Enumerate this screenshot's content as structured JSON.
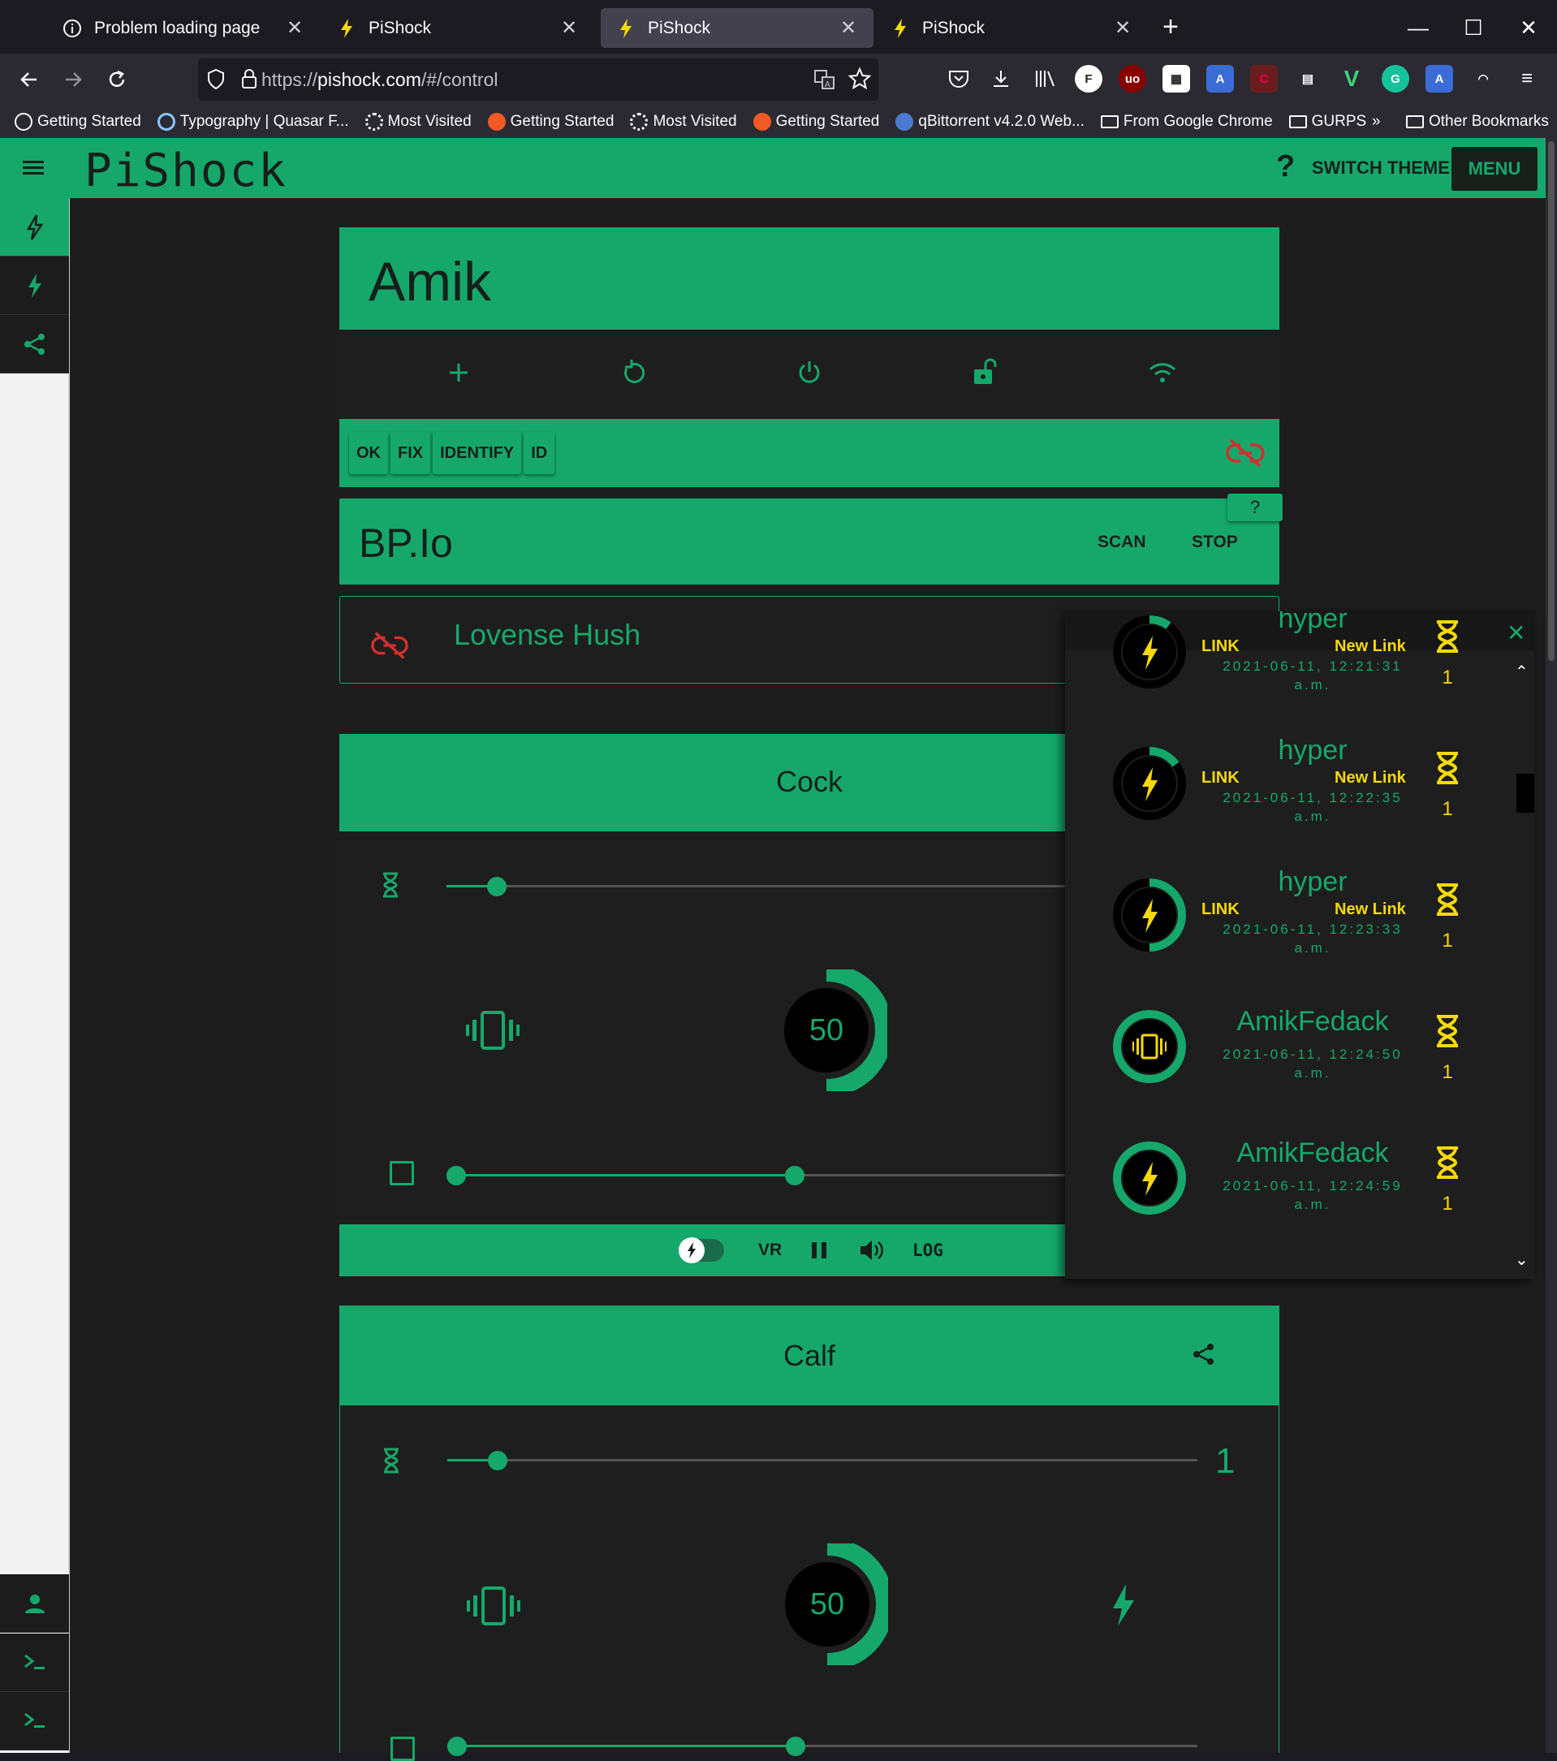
{
  "browser": {
    "tabs": [
      {
        "label": "Problem loading page",
        "icon": "info-icon",
        "active": false
      },
      {
        "label": "PiShock",
        "icon": "lightning-favicon",
        "active": false
      },
      {
        "label": "PiShock",
        "icon": "lightning-favicon",
        "active": true
      },
      {
        "label": "PiShock",
        "icon": "lightning-favicon",
        "active": false
      }
    ],
    "url_prefix": "https://",
    "url_host": "pishock.com",
    "url_path": "/#/control",
    "bookmarks": [
      {
        "label": "Getting Started",
        "icon": "globe-icon"
      },
      {
        "label": "Typography | Quasar F...",
        "icon": "quasar-icon"
      },
      {
        "label": "Most Visited",
        "icon": "gear-icon"
      },
      {
        "label": "Getting Started",
        "icon": "firefox-icon"
      },
      {
        "label": "Most Visited",
        "icon": "gear-icon"
      },
      {
        "label": "Getting Started",
        "icon": "firefox-icon"
      },
      {
        "label": "qBittorrent v4.2.0 Web...",
        "icon": "qbittorrent-icon"
      },
      {
        "label": "From Google Chrome",
        "icon": "folder-icon"
      },
      {
        "label": "GURPS",
        "icon": "folder-icon"
      }
    ],
    "other_bookmarks": "Other Bookmarks"
  },
  "app": {
    "logo": "PiShock",
    "help": "?",
    "switch_theme": "SWITCH THEME",
    "menu": "MENU",
    "accent": "#16a86b",
    "warn": "#f5d90a",
    "error": "#d32f2f"
  },
  "hub": {
    "name": "Amik",
    "actions": [
      "OK",
      "FIX",
      "IDENTIFY",
      "ID"
    ]
  },
  "bpio": {
    "title": "BP.Io",
    "scan": "SCAN",
    "stop": "STOP",
    "help": "?"
  },
  "device": {
    "name": "Lovense Hush"
  },
  "shockers": [
    {
      "name": "Cock",
      "intensity": "50",
      "duration_value": "1",
      "vr": "VR",
      "log": "LOG"
    },
    {
      "name": "Calf",
      "intensity": "50",
      "duration_value": "1"
    }
  ],
  "log": {
    "items": [
      {
        "name": "hyper",
        "type": "shock",
        "link": "LINK",
        "new_link": "New Link",
        "date": "2021-06-11, 12:21:31",
        "ampm": "a.m.",
        "count": "1",
        "ring": 0.1
      },
      {
        "name": "hyper",
        "type": "shock",
        "link": "LINK",
        "new_link": "New Link",
        "date": "2021-06-11, 12:22:35",
        "ampm": "a.m.",
        "count": "1",
        "ring": 0.15
      },
      {
        "name": "hyper",
        "type": "shock",
        "link": "LINK",
        "new_link": "New Link",
        "date": "2021-06-11, 12:23:33",
        "ampm": "a.m.",
        "count": "1",
        "ring": 0.5
      },
      {
        "name": "AmikFedack",
        "type": "vibrate",
        "date": "2021-06-11, 12:24:50",
        "ampm": "a.m.",
        "count": "1",
        "ring": 1.0
      },
      {
        "name": "AmikFedack",
        "type": "shock",
        "date": "2021-06-11, 12:24:59",
        "ampm": "a.m.",
        "count": "1",
        "ring": 1.0
      }
    ]
  }
}
